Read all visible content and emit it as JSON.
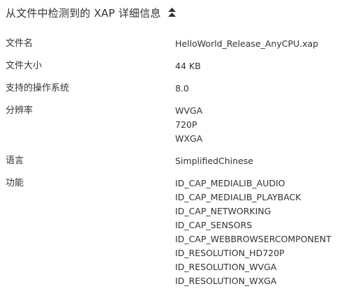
{
  "header": {
    "title": "从文件中检测到的 XAP 详细信息",
    "toggle_icon": "chevron-double-up-icon"
  },
  "details": {
    "file_name": {
      "label": "文件名",
      "value": "HelloWorld_Release_AnyCPU.xap"
    },
    "file_size": {
      "label": "文件大小",
      "value": "44 KB"
    },
    "supported_os": {
      "label": "支持的操作系统",
      "value": "8.0"
    },
    "resolution": {
      "label": "分辨率",
      "values": [
        "WVGA",
        "720P",
        "WXGA"
      ]
    },
    "language": {
      "label": "语言",
      "value": "SimplifiedChinese"
    },
    "capabilities": {
      "label": "功能",
      "values": [
        "ID_CAP_MEDIALIB_AUDIO",
        "ID_CAP_MEDIALIB_PLAYBACK",
        "ID_CAP_NETWORKING",
        "ID_CAP_SENSORS",
        "ID_CAP_WEBBROWSERCOMPONENT",
        "ID_RESOLUTION_HD720P",
        "ID_RESOLUTION_WVGA",
        "ID_RESOLUTION_WXGA"
      ]
    }
  }
}
